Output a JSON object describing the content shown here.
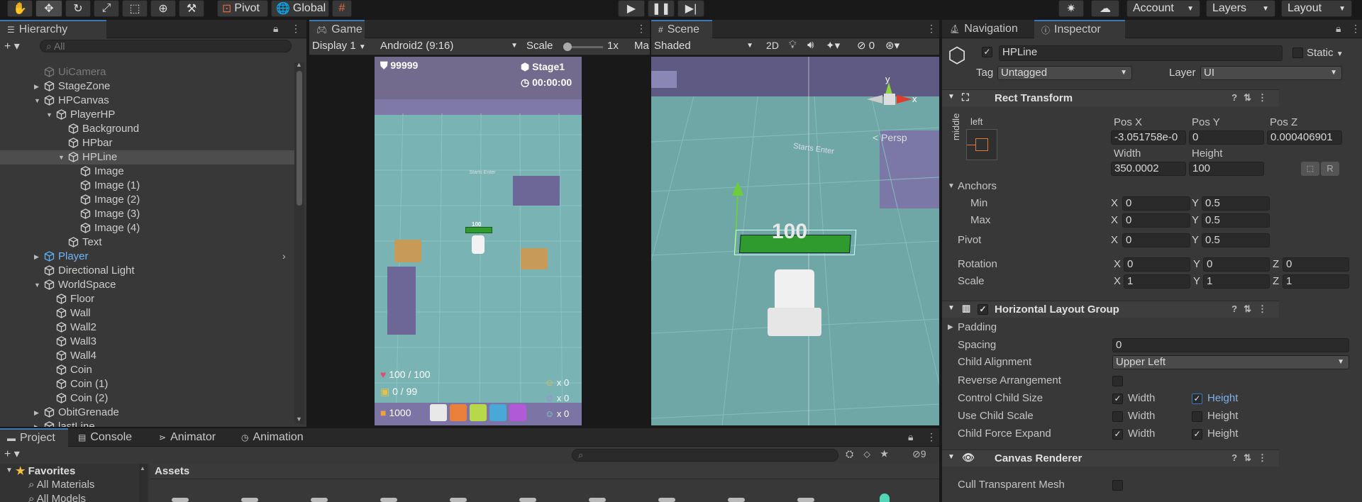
{
  "toolbar": {
    "pivot_label": "Pivot",
    "global_label": "Global",
    "account_label": "Account",
    "layers_label": "Layers",
    "layout_label": "Layout"
  },
  "hierarchy": {
    "tab_label": "Hierarchy",
    "search_placeholder": "All",
    "items": [
      {
        "label": "UiCamera",
        "depth": 1,
        "arrow": "",
        "kind": "gray"
      },
      {
        "label": "StageZone",
        "depth": 1,
        "arrow": "right",
        "kind": "normal"
      },
      {
        "label": "HPCanvas",
        "depth": 1,
        "arrow": "down",
        "kind": "normal"
      },
      {
        "label": "PlayerHP",
        "depth": 2,
        "arrow": "down",
        "kind": "normal"
      },
      {
        "label": "Background",
        "depth": 3,
        "arrow": "",
        "kind": "normal"
      },
      {
        "label": "HPbar",
        "depth": 3,
        "arrow": "",
        "kind": "normal"
      },
      {
        "label": "HPLine",
        "depth": 3,
        "arrow": "down",
        "kind": "selected"
      },
      {
        "label": "Image",
        "depth": 4,
        "arrow": "",
        "kind": "normal"
      },
      {
        "label": "Image (1)",
        "depth": 4,
        "arrow": "",
        "kind": "normal"
      },
      {
        "label": "Image (2)",
        "depth": 4,
        "arrow": "",
        "kind": "normal"
      },
      {
        "label": "Image (3)",
        "depth": 4,
        "arrow": "",
        "kind": "normal"
      },
      {
        "label": "Image (4)",
        "depth": 4,
        "arrow": "",
        "kind": "normal"
      },
      {
        "label": "Text",
        "depth": 3,
        "arrow": "",
        "kind": "normal"
      },
      {
        "label": "Player",
        "depth": 1,
        "arrow": "right",
        "kind": "prefab"
      },
      {
        "label": "Directional Light",
        "depth": 1,
        "arrow": "",
        "kind": "normal"
      },
      {
        "label": "WorldSpace",
        "depth": 1,
        "arrow": "down",
        "kind": "normal"
      },
      {
        "label": "Floor",
        "depth": 2,
        "arrow": "",
        "kind": "normal"
      },
      {
        "label": "Wall",
        "depth": 2,
        "arrow": "",
        "kind": "normal"
      },
      {
        "label": "Wall2",
        "depth": 2,
        "arrow": "",
        "kind": "normal"
      },
      {
        "label": "Wall3",
        "depth": 2,
        "arrow": "",
        "kind": "normal"
      },
      {
        "label": "Wall4",
        "depth": 2,
        "arrow": "",
        "kind": "normal"
      },
      {
        "label": "Coin",
        "depth": 2,
        "arrow": "",
        "kind": "normal"
      },
      {
        "label": "Coin (1)",
        "depth": 2,
        "arrow": "",
        "kind": "normal"
      },
      {
        "label": "Coin (2)",
        "depth": 2,
        "arrow": "",
        "kind": "normal"
      },
      {
        "label": "ObitGrenade",
        "depth": 1,
        "arrow": "right",
        "kind": "normal"
      },
      {
        "label": "lastLine",
        "depth": 1,
        "arrow": "right",
        "kind": "normal"
      }
    ]
  },
  "game": {
    "tab_label": "Game",
    "display": "Display 1",
    "resolution": "Android2 (9:16)",
    "scale_label": "Scale",
    "scale_value": "1x",
    "more": "Ma",
    "hud": {
      "score": "99999",
      "stage": "Stage1",
      "time": "00:00:00",
      "hp": "100 / 100",
      "ammo": "0 / 99",
      "coins": "1000",
      "count1": "x 0",
      "count2": "x 0",
      "count3": "x 0",
      "hp_tag": "100"
    }
  },
  "scene": {
    "tab_label": "Scene",
    "shading": "Shaded",
    "mode_2d": "2D",
    "hidden_count": "0",
    "persp_label": "< Persp",
    "axis_y": "y",
    "axis_x": "x",
    "overlay_number": "100",
    "floor_text": "Starts Enter",
    "colors": {
      "hp_green": "#2f9b2f",
      "floor": "#7fb6b4",
      "wall": "#7b77a6"
    }
  },
  "inspector": {
    "tab_nav": "Navigation",
    "tab_inspector": "Inspector",
    "name": "HPLine",
    "static_label": "Static",
    "tag_label": "Tag",
    "tag_value": "Untagged",
    "layer_label": "Layer",
    "layer_value": "UI",
    "rect_transform": {
      "title": "Rect Transform",
      "anchor_left": "left",
      "anchor_middle": "middle",
      "posx_label": "Pos X",
      "posy_label": "Pos Y",
      "posz_label": "Pos Z",
      "posx": "-3.051758e-0",
      "posy": "0",
      "posz": "0.000406901",
      "width_label": "Width",
      "height_label": "Height",
      "width": "350.0002",
      "height": "100",
      "r_btn": "R",
      "anchors_label": "Anchors",
      "min_label": "Min",
      "max_label": "Max",
      "min_x": "0",
      "min_y": "0.5",
      "max_x": "0",
      "max_y": "0.5",
      "pivot_label": "Pivot",
      "pivot_x": "0",
      "pivot_y": "0.5",
      "rotation_label": "Rotation",
      "rot_x": "0",
      "rot_y": "0",
      "rot_z": "0",
      "scale_label": "Scale",
      "scale_x": "1",
      "scale_y": "1",
      "scale_z": "1",
      "x": "X",
      "y": "Y",
      "z": "Z"
    },
    "hlg": {
      "title": "Horizontal Layout Group",
      "padding_label": "Padding",
      "spacing_label": "Spacing",
      "spacing": "0",
      "child_alignment_label": "Child Alignment",
      "child_alignment": "Upper Left",
      "reverse_label": "Reverse Arrangement",
      "control_size_label": "Control Child Size",
      "use_scale_label": "Use Child Scale",
      "force_expand_label": "Child Force Expand",
      "width_label": "Width",
      "height_label": "Height"
    },
    "canvas_renderer": {
      "title": "Canvas Renderer",
      "cull_label": "Cull Transparent Mesh"
    }
  },
  "bottom": {
    "tab_project": "Project",
    "tab_console": "Console",
    "tab_animator": "Animator",
    "tab_animation": "Animation",
    "favorites": "Favorites",
    "fav_items": [
      "All Materials",
      "All Models"
    ],
    "assets": "Assets",
    "hidden_count": "9"
  }
}
